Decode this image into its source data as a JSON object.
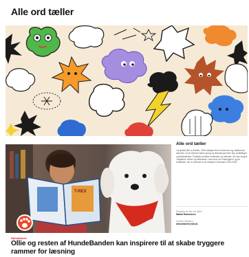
{
  "page": {
    "title": "Alle ord tæller"
  },
  "banner": {
    "icon": "illustration-doodles"
  },
  "card": {
    "image_icon": "photo-boy-reading-with-dog",
    "book_cover_text": "T-REX",
    "tag": "Nyhedsbrev",
    "headline": "Ollie og resten af HundeBanden kan inspirere til at skabe tryggere rammer for læsning"
  },
  "sidebar": {
    "title": "Alle ord tæller",
    "body": "I projektet Alle ord tæller, 2025 arbejder flere kommuner og institutioner sammen om at fremme børns sprog og læselyst gennem leg, fortællinger og fællesskaber. Projektet udvikler materialer og metoder, der kan bruges i dagtilbud, skoler og biblioteker. Læs mere om erfaringerne og de redskaber, der er kommet ud af arbejdet i Danmark 2023-2025.",
    "meta": [
      {
        "label": "Redaktør for alle ord tæller",
        "value": "Malida Rasmussen"
      },
      {
        "label": "Kontakt redaktion",
        "value": "alleordtaeller@dk.dk"
      }
    ]
  },
  "colors": {
    "banner_bg": "#f6ead6",
    "accent_red": "#c8102e",
    "title_text": "#111111"
  }
}
